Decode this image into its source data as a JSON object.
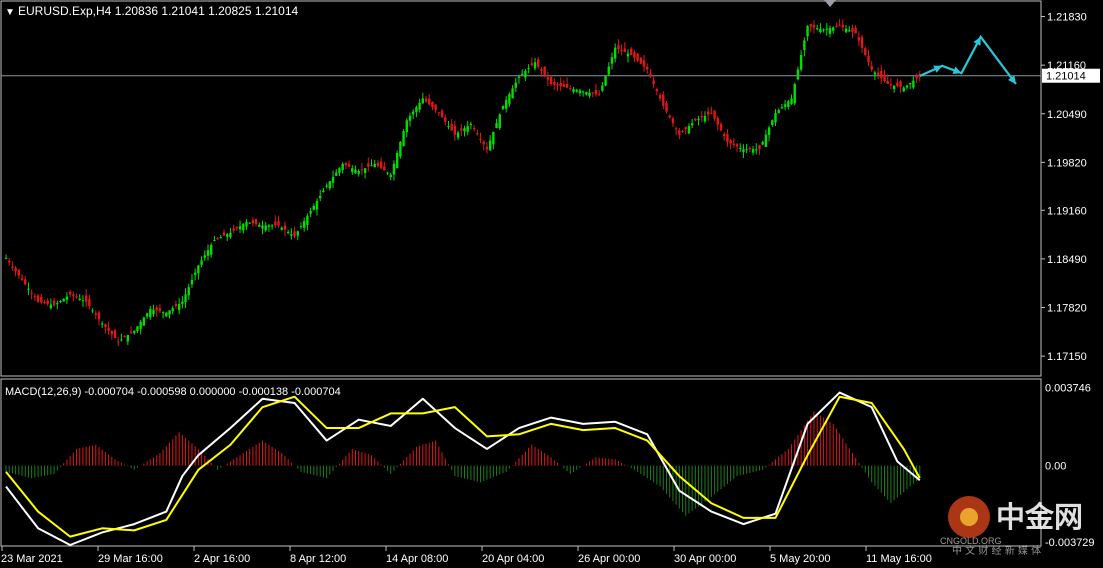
{
  "header": {
    "symbol_line": "EURUSD.Exp,H4  1.20836 1.21041 1.20825 1.21014",
    "menu_glyph": "▼"
  },
  "macd_header": "MACD(12,26,9) -0.000704 -0.000598 0.000000 -0.000138 -0.000704",
  "colors": {
    "background": "#000000",
    "frame": "#c0c0c0",
    "bull": "#00e000",
    "bear": "#e01818",
    "macd_main": "#ffffff",
    "macd_signal": "#ffff00",
    "hist_pos": "#e01818",
    "hist_neg": "#1a7f1a",
    "projection": "#28c8d8",
    "bid_line": "#8a96a0"
  },
  "watermark": {
    "brand": "中金网",
    "domain": "CNGOLD.ORG",
    "tagline": "中 文 财 经 新 媒 体"
  },
  "chart_data": [
    {
      "type": "candlestick",
      "title": "EURUSD.Exp,H4",
      "ohlc_last": {
        "open": 1.20836,
        "high": 1.21041,
        "low": 1.20825,
        "close": 1.21014
      },
      "current_price": 1.21014,
      "current_price_label": "1.21014",
      "ylim": [
        1.1689,
        1.2203
      ],
      "y_ticks": [
        1.1715,
        1.1782,
        1.1849,
        1.1916,
        1.1982,
        1.2049,
        1.2116,
        1.2183
      ],
      "y_tick_labels": [
        "1.17150",
        "1.17820",
        "1.18490",
        "1.19160",
        "1.19820",
        "1.20490",
        "1.21160",
        "1.21830"
      ],
      "x_tick_labels": [
        "23 Mar 2021",
        "29 Mar 16:00",
        "2 Apr 16:00",
        "8 Apr 12:00",
        "14 Apr 08:00",
        "20 Apr 04:00",
        "26 Apr 00:00",
        "30 Apr 00:00",
        "5 May 20:00",
        "11 May 16:00"
      ],
      "close_path": [
        [
          0,
          1.185
        ],
        [
          5,
          1.182
        ],
        [
          10,
          1.179
        ],
        [
          15,
          1.1785
        ],
        [
          20,
          1.18
        ],
        [
          25,
          1.179
        ],
        [
          30,
          1.176
        ],
        [
          35,
          1.1735
        ],
        [
          40,
          1.175
        ],
        [
          45,
          1.178
        ],
        [
          50,
          1.1775
        ],
        [
          55,
          1.179
        ],
        [
          60,
          1.184
        ],
        [
          65,
          1.1875
        ],
        [
          70,
          1.1885
        ],
        [
          75,
          1.19
        ],
        [
          80,
          1.1895
        ],
        [
          85,
          1.1895
        ],
        [
          90,
          1.188
        ],
        [
          95,
          1.1915
        ],
        [
          100,
          1.195
        ],
        [
          105,
          1.198
        ],
        [
          110,
          1.197
        ],
        [
          115,
          1.198
        ],
        [
          120,
          1.1965
        ],
        [
          125,
          1.204
        ],
        [
          130,
          1.207
        ],
        [
          135,
          1.205
        ],
        [
          140,
          1.202
        ],
        [
          145,
          1.2035
        ],
        [
          150,
          1.2
        ],
        [
          155,
          1.206
        ],
        [
          160,
          1.21
        ],
        [
          165,
          1.212
        ],
        [
          170,
          1.209
        ],
        [
          175,
          1.2085
        ],
        [
          180,
          1.208
        ],
        [
          185,
          1.2075
        ],
        [
          190,
          1.214
        ],
        [
          195,
          1.213
        ],
        [
          200,
          1.211
        ],
        [
          205,
          1.206
        ],
        [
          210,
          1.202
        ],
        [
          215,
          1.204
        ],
        [
          220,
          1.205
        ],
        [
          225,
          1.201
        ],
        [
          230,
          1.2
        ],
        [
          235,
          1.2
        ],
        [
          240,
          1.205
        ],
        [
          245,
          1.207
        ],
        [
          250,
          1.217
        ],
        [
          255,
          1.2165
        ],
        [
          260,
          1.217
        ],
        [
          265,
          1.216
        ],
        [
          270,
          1.211
        ],
        [
          275,
          1.209
        ],
        [
          280,
          1.2085
        ],
        [
          285,
          1.2101
        ]
      ],
      "projection": [
        [
          285,
          1.2101
        ],
        [
          292,
          1.2115
        ],
        [
          298,
          1.2105
        ],
        [
          304,
          1.2155
        ],
        [
          315,
          1.209
        ]
      ]
    },
    {
      "type": "line",
      "title": "MACD(12,26,9)",
      "ylim": [
        -0.0038,
        0.0041
      ],
      "y_ticks": [
        0.003746,
        0.0,
        -0.003729
      ],
      "y_tick_labels": [
        "0.003746",
        "0.00",
        "-0.003729"
      ],
      "series": [
        {
          "name": "main",
          "style": "line",
          "values": [
            [
              0,
              -0.001
            ],
            [
              10,
              -0.003
            ],
            [
              20,
              -0.0038
            ],
            [
              30,
              -0.0032
            ],
            [
              40,
              -0.0028
            ],
            [
              50,
              -0.0022
            ],
            [
              55,
              -0.0005
            ],
            [
              60,
              0.0005
            ],
            [
              70,
              0.0018
            ],
            [
              80,
              0.0032
            ],
            [
              90,
              0.003
            ],
            [
              100,
              0.0012
            ],
            [
              110,
              0.0022
            ],
            [
              120,
              0.0019
            ],
            [
              130,
              0.0032
            ],
            [
              140,
              0.0018
            ],
            [
              150,
              0.0008
            ],
            [
              160,
              0.0018
            ],
            [
              170,
              0.0023
            ],
            [
              180,
              0.002
            ],
            [
              190,
              0.0021
            ],
            [
              200,
              0.0015
            ],
            [
              210,
              -0.0012
            ],
            [
              220,
              -0.0022
            ],
            [
              230,
              -0.0028
            ],
            [
              240,
              -0.0023
            ],
            [
              250,
              0.002
            ],
            [
              260,
              0.0035
            ],
            [
              270,
              0.0028
            ],
            [
              278,
              0.0002
            ],
            [
              285,
              -0.0007
            ]
          ]
        },
        {
          "name": "signal",
          "style": "line",
          "values": [
            [
              0,
              -0.0003
            ],
            [
              10,
              -0.0022
            ],
            [
              20,
              -0.0034
            ],
            [
              30,
              -0.003
            ],
            [
              40,
              -0.0031
            ],
            [
              50,
              -0.0026
            ],
            [
              60,
              -0.0002
            ],
            [
              70,
              0.001
            ],
            [
              80,
              0.0028
            ],
            [
              90,
              0.0033
            ],
            [
              100,
              0.0018
            ],
            [
              110,
              0.0018
            ],
            [
              120,
              0.0025
            ],
            [
              130,
              0.0025
            ],
            [
              140,
              0.0028
            ],
            [
              150,
              0.0014
            ],
            [
              160,
              0.0015
            ],
            [
              170,
              0.002
            ],
            [
              180,
              0.0017
            ],
            [
              190,
              0.0018
            ],
            [
              200,
              0.0012
            ],
            [
              210,
              -0.0005
            ],
            [
              220,
              -0.0018
            ],
            [
              230,
              -0.0025
            ],
            [
              240,
              -0.0025
            ],
            [
              250,
              0.0005
            ],
            [
              260,
              0.0033
            ],
            [
              270,
              0.003
            ],
            [
              280,
              0.0008
            ],
            [
              285,
              -0.0006
            ]
          ]
        },
        {
          "name": "histogram",
          "style": "bars",
          "values": [
            [
              0,
              -0.0003
            ],
            [
              8,
              -0.0006
            ],
            [
              15,
              -0.0004
            ],
            [
              22,
              0.0008
            ],
            [
              28,
              0.001
            ],
            [
              34,
              0.0003
            ],
            [
              40,
              -0.0002
            ],
            [
              48,
              0.0006
            ],
            [
              54,
              0.0016
            ],
            [
              60,
              0.0008
            ],
            [
              66,
              -0.0002
            ],
            [
              72,
              0.0004
            ],
            [
              80,
              0.0012
            ],
            [
              86,
              0.0006
            ],
            [
              92,
              -0.0003
            ],
            [
              100,
              -0.0006
            ],
            [
              108,
              0.0008
            ],
            [
              114,
              0.0005
            ],
            [
              120,
              -0.0004
            ],
            [
              128,
              0.0009
            ],
            [
              134,
              0.0012
            ],
            [
              140,
              -0.0005
            ],
            [
              148,
              -0.0008
            ],
            [
              156,
              -0.0003
            ],
            [
              164,
              0.001
            ],
            [
              170,
              0.0004
            ],
            [
              176,
              -0.0004
            ],
            [
              184,
              0.0004
            ],
            [
              190,
              0.0003
            ],
            [
              196,
              -0.0002
            ],
            [
              204,
              -0.001
            ],
            [
              212,
              -0.0024
            ],
            [
              220,
              -0.0015
            ],
            [
              228,
              -0.0005
            ],
            [
              236,
              -0.0002
            ],
            [
              244,
              0.0008
            ],
            [
              252,
              0.0026
            ],
            [
              258,
              0.002
            ],
            [
              264,
              0.0006
            ],
            [
              270,
              -0.0008
            ],
            [
              276,
              -0.0018
            ],
            [
              282,
              -0.001
            ],
            [
              285,
              -0.0006
            ]
          ]
        }
      ]
    }
  ]
}
